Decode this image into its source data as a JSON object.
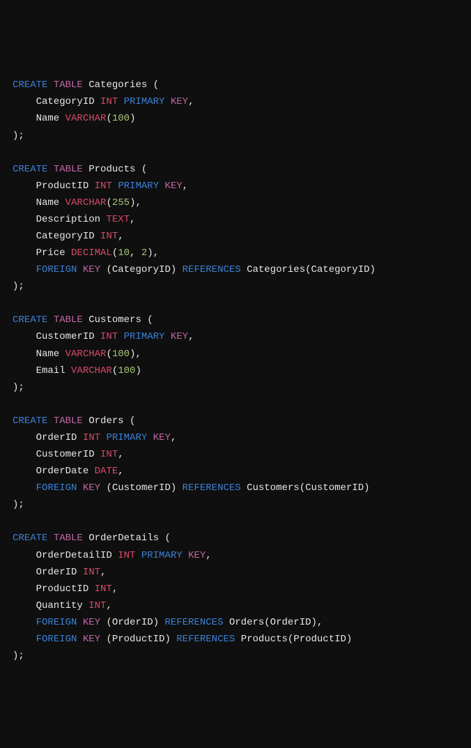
{
  "code": {
    "tokens": [
      [
        {
          "t": "CREATE ",
          "c": "kw-blue"
        },
        {
          "t": "TABLE ",
          "c": "kw-ctrl"
        },
        {
          "t": "Categories (",
          "c": "id"
        }
      ],
      [
        {
          "t": "    CategoryID ",
          "c": "id"
        },
        {
          "t": "INT ",
          "c": "typ"
        },
        {
          "t": "PRIMARY ",
          "c": "kw-blue"
        },
        {
          "t": "KEY",
          "c": "kw-ctrl"
        },
        {
          "t": ",",
          "c": "id"
        }
      ],
      [
        {
          "t": "    Name ",
          "c": "id"
        },
        {
          "t": "VARCHAR",
          "c": "typ"
        },
        {
          "t": "(",
          "c": "id"
        },
        {
          "t": "100",
          "c": "num"
        },
        {
          "t": ")",
          "c": "id"
        }
      ],
      [
        {
          "t": ");",
          "c": "id"
        }
      ],
      [],
      [
        {
          "t": "CREATE ",
          "c": "kw-blue"
        },
        {
          "t": "TABLE ",
          "c": "kw-ctrl"
        },
        {
          "t": "Products (",
          "c": "id"
        }
      ],
      [
        {
          "t": "    ProductID ",
          "c": "id"
        },
        {
          "t": "INT ",
          "c": "typ"
        },
        {
          "t": "PRIMARY ",
          "c": "kw-blue"
        },
        {
          "t": "KEY",
          "c": "kw-ctrl"
        },
        {
          "t": ",",
          "c": "id"
        }
      ],
      [
        {
          "t": "    Name ",
          "c": "id"
        },
        {
          "t": "VARCHAR",
          "c": "typ"
        },
        {
          "t": "(",
          "c": "id"
        },
        {
          "t": "255",
          "c": "num"
        },
        {
          "t": "),",
          "c": "id"
        }
      ],
      [
        {
          "t": "    Description ",
          "c": "id"
        },
        {
          "t": "TEXT",
          "c": "typ"
        },
        {
          "t": ",",
          "c": "id"
        }
      ],
      [
        {
          "t": "    CategoryID ",
          "c": "id"
        },
        {
          "t": "INT",
          "c": "typ"
        },
        {
          "t": ",",
          "c": "id"
        }
      ],
      [
        {
          "t": "    Price ",
          "c": "id"
        },
        {
          "t": "DECIMAL",
          "c": "typ"
        },
        {
          "t": "(",
          "c": "id"
        },
        {
          "t": "10",
          "c": "num"
        },
        {
          "t": ", ",
          "c": "id"
        },
        {
          "t": "2",
          "c": "num"
        },
        {
          "t": "),",
          "c": "id"
        }
      ],
      [
        {
          "t": "    ",
          "c": "id"
        },
        {
          "t": "FOREIGN ",
          "c": "kw-blue"
        },
        {
          "t": "KEY ",
          "c": "kw-ctrl"
        },
        {
          "t": "(CategoryID) ",
          "c": "id"
        },
        {
          "t": "REFERENCES ",
          "c": "kw-blue"
        },
        {
          "t": "Categories(CategoryID)",
          "c": "id"
        }
      ],
      [
        {
          "t": ");",
          "c": "id"
        }
      ],
      [],
      [
        {
          "t": "CREATE ",
          "c": "kw-blue"
        },
        {
          "t": "TABLE ",
          "c": "kw-ctrl"
        },
        {
          "t": "Customers (",
          "c": "id"
        }
      ],
      [
        {
          "t": "    CustomerID ",
          "c": "id"
        },
        {
          "t": "INT ",
          "c": "typ"
        },
        {
          "t": "PRIMARY ",
          "c": "kw-blue"
        },
        {
          "t": "KEY",
          "c": "kw-ctrl"
        },
        {
          "t": ",",
          "c": "id"
        }
      ],
      [
        {
          "t": "    Name ",
          "c": "id"
        },
        {
          "t": "VARCHAR",
          "c": "typ"
        },
        {
          "t": "(",
          "c": "id"
        },
        {
          "t": "100",
          "c": "num"
        },
        {
          "t": "),",
          "c": "id"
        }
      ],
      [
        {
          "t": "    Email ",
          "c": "id"
        },
        {
          "t": "VARCHAR",
          "c": "typ"
        },
        {
          "t": "(",
          "c": "id"
        },
        {
          "t": "100",
          "c": "num"
        },
        {
          "t": ")",
          "c": "id"
        }
      ],
      [
        {
          "t": ");",
          "c": "id"
        }
      ],
      [],
      [
        {
          "t": "CREATE ",
          "c": "kw-blue"
        },
        {
          "t": "TABLE ",
          "c": "kw-ctrl"
        },
        {
          "t": "Orders (",
          "c": "id"
        }
      ],
      [
        {
          "t": "    OrderID ",
          "c": "id"
        },
        {
          "t": "INT ",
          "c": "typ"
        },
        {
          "t": "PRIMARY ",
          "c": "kw-blue"
        },
        {
          "t": "KEY",
          "c": "kw-ctrl"
        },
        {
          "t": ",",
          "c": "id"
        }
      ],
      [
        {
          "t": "    CustomerID ",
          "c": "id"
        },
        {
          "t": "INT",
          "c": "typ"
        },
        {
          "t": ",",
          "c": "id"
        }
      ],
      [
        {
          "t": "    OrderDate ",
          "c": "id"
        },
        {
          "t": "DATE",
          "c": "typ"
        },
        {
          "t": ",",
          "c": "id"
        }
      ],
      [
        {
          "t": "    ",
          "c": "id"
        },
        {
          "t": "FOREIGN ",
          "c": "kw-blue"
        },
        {
          "t": "KEY ",
          "c": "kw-ctrl"
        },
        {
          "t": "(CustomerID) ",
          "c": "id"
        },
        {
          "t": "REFERENCES ",
          "c": "kw-blue"
        },
        {
          "t": "Customers(CustomerID)",
          "c": "id"
        }
      ],
      [
        {
          "t": ");",
          "c": "id"
        }
      ],
      [],
      [
        {
          "t": "CREATE ",
          "c": "kw-blue"
        },
        {
          "t": "TABLE ",
          "c": "kw-ctrl"
        },
        {
          "t": "OrderDetails (",
          "c": "id"
        }
      ],
      [
        {
          "t": "    OrderDetailID ",
          "c": "id"
        },
        {
          "t": "INT ",
          "c": "typ"
        },
        {
          "t": "PRIMARY ",
          "c": "kw-blue"
        },
        {
          "t": "KEY",
          "c": "kw-ctrl"
        },
        {
          "t": ",",
          "c": "id"
        }
      ],
      [
        {
          "t": "    OrderID ",
          "c": "id"
        },
        {
          "t": "INT",
          "c": "typ"
        },
        {
          "t": ",",
          "c": "id"
        }
      ],
      [
        {
          "t": "    ProductID ",
          "c": "id"
        },
        {
          "t": "INT",
          "c": "typ"
        },
        {
          "t": ",",
          "c": "id"
        }
      ],
      [
        {
          "t": "    Quantity ",
          "c": "id"
        },
        {
          "t": "INT",
          "c": "typ"
        },
        {
          "t": ",",
          "c": "id"
        }
      ],
      [
        {
          "t": "    ",
          "c": "id"
        },
        {
          "t": "FOREIGN ",
          "c": "kw-blue"
        },
        {
          "t": "KEY ",
          "c": "kw-ctrl"
        },
        {
          "t": "(OrderID) ",
          "c": "id"
        },
        {
          "t": "REFERENCES ",
          "c": "kw-blue"
        },
        {
          "t": "Orders(OrderID),",
          "c": "id"
        }
      ],
      [
        {
          "t": "    ",
          "c": "id"
        },
        {
          "t": "FOREIGN ",
          "c": "kw-blue"
        },
        {
          "t": "KEY ",
          "c": "kw-ctrl"
        },
        {
          "t": "(ProductID) ",
          "c": "id"
        },
        {
          "t": "REFERENCES ",
          "c": "kw-blue"
        },
        {
          "t": "Products(ProductID)",
          "c": "id"
        }
      ],
      [
        {
          "t": ");",
          "c": "id"
        }
      ]
    ]
  }
}
